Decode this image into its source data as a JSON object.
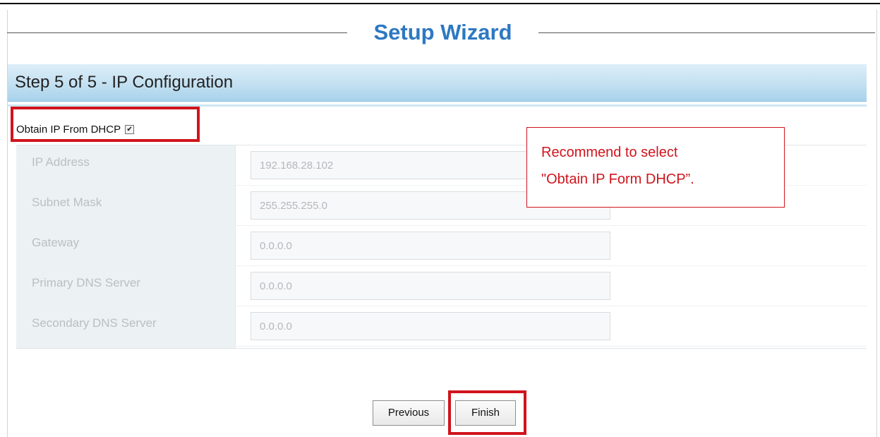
{
  "wizard": {
    "title": "Setup Wizard"
  },
  "step": {
    "title": "Step 5 of 5 - IP Configuration"
  },
  "dhcp": {
    "label": "Obtain IP From DHCP",
    "checked": true
  },
  "fields": [
    {
      "label": "IP Address",
      "value": "192.168.28.102"
    },
    {
      "label": "Subnet Mask",
      "value": "255.255.255.0"
    },
    {
      "label": "Gateway",
      "value": "0.0.0.0"
    },
    {
      "label": "Primary DNS Server",
      "value": "0.0.0.0"
    },
    {
      "label": "Secondary DNS Server",
      "value": "0.0.0.0"
    }
  ],
  "callout": {
    "line1": "Recommend to select",
    "line2": "\"Obtain IP Form DHCP”."
  },
  "buttons": {
    "previous": "Previous",
    "finish": "Finish"
  },
  "colors": {
    "title_blue": "#2e78c2",
    "highlight_red": "#d0141c",
    "header_gradient_top": "#ddeef8",
    "header_gradient_bottom": "#a7d2ec"
  },
  "icons": {
    "dhcp_checkbox": "checkbox-checked-icon"
  }
}
